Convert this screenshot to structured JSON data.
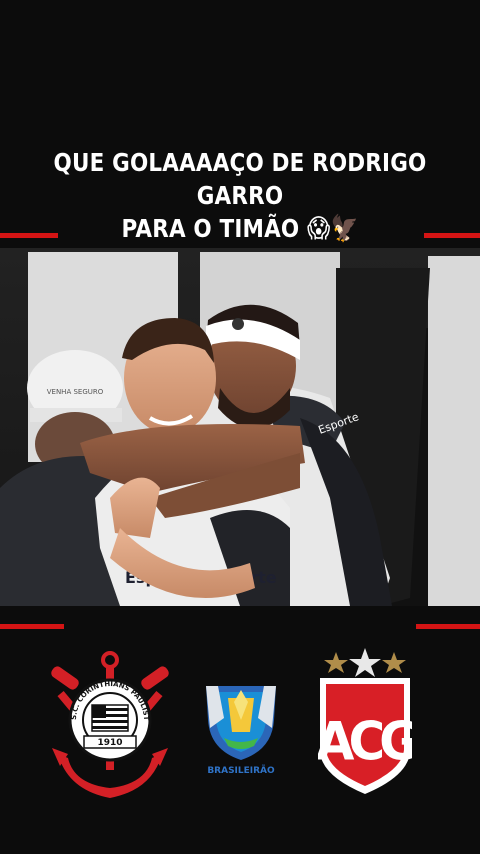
{
  "post": {
    "caption_line1": "QUE GOLAAAAÇO DE RODRIGO GARRO",
    "caption_line2": "PARA O TIMÃO",
    "caption_emojis": "😱🦅"
  },
  "photo": {
    "jersey_text_left": "Esporte da Sorte",
    "jersey_text_right": "Esporte da Sorte",
    "sleeve_text": "Esporte",
    "helmet_text": "VENHA SEGURO"
  },
  "logos": {
    "home": {
      "icon": "corinthians-crest-icon",
      "ring_text": "S.C. CORINTHIANS PAULISTA",
      "year": "1910"
    },
    "league": {
      "icon": "brasileirao-trophy-icon",
      "label": "BRASILEIRÃO"
    },
    "away": {
      "icon": "atletico-goianiense-crest-icon",
      "text": "ACG"
    }
  },
  "colors": {
    "accent": "#d41414",
    "background": "#0c0c0c",
    "brasileirao_blue": "#2f73c7"
  }
}
